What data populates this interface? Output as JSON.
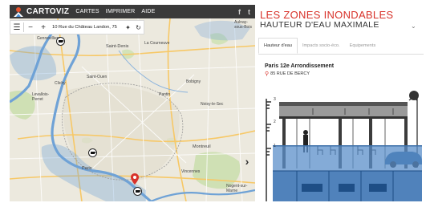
{
  "app": {
    "logo_text": "CARTOVIZ",
    "nav": [
      "CARTES",
      "IMPRIMER",
      "AIDE"
    ],
    "social": [
      "f",
      "t"
    ]
  },
  "toolbar": {
    "address_value": "10 Rue du Château Landon, 75"
  },
  "map": {
    "places": [
      "Gennevilliers",
      "Saint-Denis",
      "La Courneuve",
      "Aulnay-sous-Bois",
      "Saint-Ouen",
      "Clichy",
      "Levallois-Perret",
      "Pantin",
      "Bobigny",
      "Noisy-le-Sec",
      "Montreuil",
      "Paris",
      "Vincennes",
      "Nogent-sur-Marne"
    ]
  },
  "panel": {
    "title": "LES ZONES INONDABLES",
    "subtitle": "HAUTEUR D'EAU MAXIMALE",
    "tabs": [
      "Hauteur d'eau",
      "Impacts socio-éco.",
      "Equipements"
    ],
    "location_name": "Paris 12e Arrondissement",
    "location_address": "85 RUE DE BERCY",
    "scale": [
      "3",
      "2",
      "1"
    ]
  },
  "colors": {
    "accent": "#d8322a",
    "navbar": "#3a3a3a",
    "water": "#5b8fc9",
    "river": "#6fa2d6"
  }
}
